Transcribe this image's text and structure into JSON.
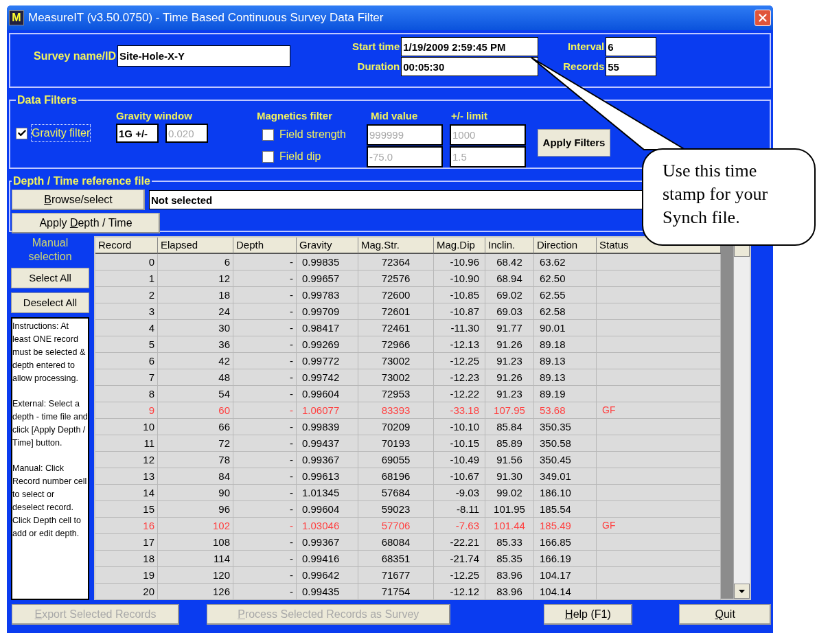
{
  "window": {
    "app_icon_letter": "M",
    "title": "MeasureIT (v3.50.0750) - Time Based Continuous Survey Data Filter"
  },
  "survey": {
    "name_label": "Survey name/ID",
    "name_value": "Site-Hole-X-Y",
    "start_label": "Start time",
    "start_value": "1/19/2009 2:59:45 PM",
    "duration_label": "Duration",
    "duration_value": "00:05:30",
    "interval_label": "Interval",
    "interval_value": "6",
    "records_label": "Records",
    "records_value": "55"
  },
  "data_filters": {
    "legend": "Data Filters",
    "gravity_filter": {
      "label": "Gravity filter",
      "checked": true,
      "focused": true
    },
    "gravity_window_label": "Gravity window",
    "gravity_window_mode": "1G +/-",
    "gravity_window_value": {
      "value": "0.020",
      "disabled": true
    },
    "magnetics_label": "Magnetics filter",
    "mid_label": "Mid value",
    "limit_label": "+/- limit",
    "magnetics": [
      {
        "label": "Field strength",
        "checked": false,
        "mid": {
          "value": "999999",
          "disabled": true
        },
        "limit": {
          "value": "1000",
          "disabled": true
        }
      },
      {
        "label": "Field dip",
        "checked": false,
        "mid": {
          "value": "-75.0",
          "disabled": true
        },
        "limit": {
          "value": "1.5",
          "disabled": true
        }
      }
    ],
    "apply_button": {
      "label": "Apply Filters"
    }
  },
  "reference_file": {
    "legend": "Depth / Time reference file",
    "browse_button": {
      "access_key": "B",
      "after": "rowse/select"
    },
    "file_value": "Not selected",
    "apply_button": {
      "before": "Apply ",
      "access_key": "D",
      "after": "epth / Time"
    }
  },
  "manual": {
    "title": "Manual selection",
    "select_all": "Select All",
    "deselect_all": "Deselect All",
    "instructions": [
      "Instructions: At least ONE record must be selected & depth entered to allow processing.",
      "External: Select a depth - time file and click [Apply Depth / Time] button.",
      "Manual: Click Record number cell to select or deselect record. Click Depth cell to add or edit depth."
    ]
  },
  "table": {
    "columns": [
      "Record",
      "Elapsed",
      "Depth",
      "Gravity",
      "Mag.Str.",
      "Mag.Dip",
      "Inclin.",
      "Direction",
      "Status"
    ],
    "rows": [
      {
        "cells": [
          "0",
          "6",
          "-",
          "0.99835",
          "72364",
          "-10.96",
          "68.42",
          "63.62"
        ],
        "flagged": false
      },
      {
        "cells": [
          "1",
          "12",
          "-",
          "0.99657",
          "72576",
          "-10.90",
          "68.94",
          "62.50"
        ],
        "flagged": false
      },
      {
        "cells": [
          "2",
          "18",
          "-",
          "0.99783",
          "72600",
          "-10.85",
          "69.02",
          "62.55"
        ],
        "flagged": false
      },
      {
        "cells": [
          "3",
          "24",
          "-",
          "0.99709",
          "72601",
          "-10.87",
          "69.03",
          "62.58"
        ],
        "flagged": false
      },
      {
        "cells": [
          "4",
          "30",
          "-",
          "0.98417",
          "72461",
          "-11.30",
          "91.77",
          "90.01"
        ],
        "flagged": false
      },
      {
        "cells": [
          "5",
          "36",
          "-",
          "0.99269",
          "72966",
          "-12.13",
          "91.26",
          "89.18"
        ],
        "flagged": false
      },
      {
        "cells": [
          "6",
          "42",
          "-",
          "0.99772",
          "73002",
          "-12.25",
          "91.23",
          "89.13"
        ],
        "flagged": false
      },
      {
        "cells": [
          "7",
          "48",
          "-",
          "0.99742",
          "73002",
          "-12.23",
          "91.26",
          "89.13"
        ],
        "flagged": false
      },
      {
        "cells": [
          "8",
          "54",
          "-",
          "0.99604",
          "72953",
          "-12.22",
          "91.23",
          "89.19"
        ],
        "flagged": false
      },
      {
        "cells": [
          "9",
          "60",
          "-",
          "1.06077",
          "83393",
          "-33.18",
          "107.95",
          "53.68"
        ],
        "status": "GF",
        "flagged": true
      },
      {
        "cells": [
          "10",
          "66",
          "-",
          "0.99839",
          "70209",
          "-10.10",
          "85.84",
          "350.35"
        ],
        "flagged": false
      },
      {
        "cells": [
          "11",
          "72",
          "-",
          "0.99437",
          "70193",
          "-10.15",
          "85.89",
          "350.58"
        ],
        "flagged": false
      },
      {
        "cells": [
          "12",
          "78",
          "-",
          "0.99367",
          "69055",
          "-10.49",
          "91.56",
          "350.45"
        ],
        "flagged": false
      },
      {
        "cells": [
          "13",
          "84",
          "-",
          "0.99613",
          "68196",
          "-10.67",
          "91.30",
          "349.01"
        ],
        "flagged": false
      },
      {
        "cells": [
          "14",
          "90",
          "-",
          "1.01345",
          "57684",
          "-9.03",
          "99.02",
          "186.10"
        ],
        "flagged": false
      },
      {
        "cells": [
          "15",
          "96",
          "-",
          "0.99604",
          "59023",
          "-8.11",
          "101.95",
          "185.54"
        ],
        "flagged": false
      },
      {
        "cells": [
          "16",
          "102",
          "-",
          "1.03046",
          "57706",
          "-7.63",
          "101.44",
          "185.49"
        ],
        "status": "GF",
        "flagged": true
      },
      {
        "cells": [
          "17",
          "108",
          "-",
          "0.99367",
          "68084",
          "-22.21",
          "85.33",
          "166.85"
        ],
        "flagged": false
      },
      {
        "cells": [
          "18",
          "114",
          "-",
          "0.99416",
          "68351",
          "-21.74",
          "85.35",
          "166.19"
        ],
        "flagged": false
      },
      {
        "cells": [
          "19",
          "120",
          "-",
          "0.99642",
          "71677",
          "-12.25",
          "83.96",
          "104.17"
        ],
        "flagged": false
      },
      {
        "cells": [
          "20",
          "126",
          "-",
          "0.99435",
          "71754",
          "-12.12",
          "83.96",
          "104.14"
        ],
        "flagged": false
      }
    ]
  },
  "footer_buttons": [
    {
      "access_key": "E",
      "after": "xport Selected Records",
      "disabled": true
    },
    {
      "access_key": "P",
      "after": "rocess Selected Records as Survey",
      "disabled": true
    },
    {
      "access_key": "H",
      "after": "elp (F1)",
      "disabled": false
    },
    {
      "access_key": "Q",
      "after": "uit",
      "disabled": false
    }
  ],
  "callout": {
    "text": "Use this time stamp for your Synch file."
  }
}
